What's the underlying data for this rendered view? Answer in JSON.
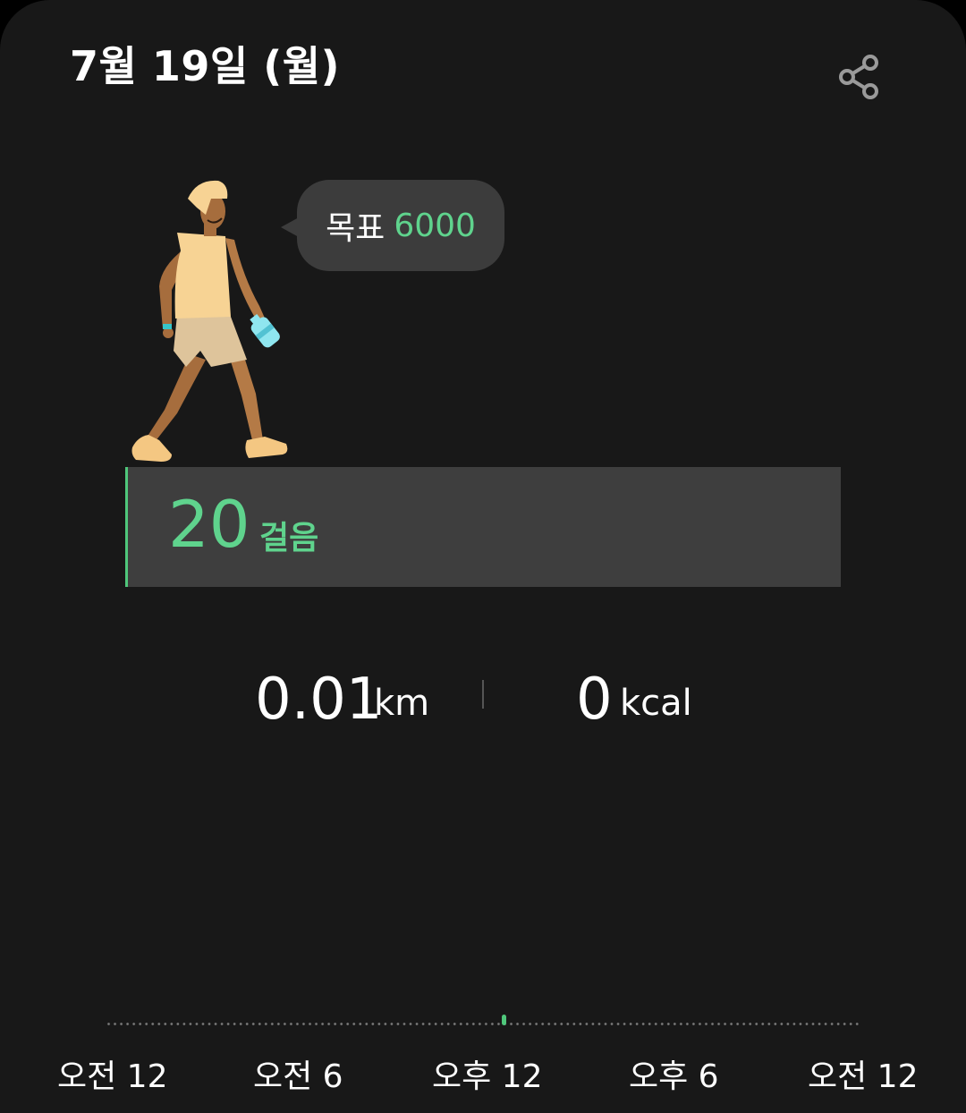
{
  "header": {
    "date": "7월 19일 (월)",
    "share_icon": "share-icon"
  },
  "goal": {
    "label": "목표",
    "value": "6000"
  },
  "steps": {
    "count": "20",
    "unit": "걸음"
  },
  "distance": {
    "value": "0.01",
    "unit": "km"
  },
  "calories": {
    "value": "0",
    "unit": "kcal"
  },
  "timeline": {
    "ticks": [
      "오전 12",
      "오전 6",
      "오후 12",
      "오후 6",
      "오전 12"
    ],
    "accent_color": "#5fd38d"
  }
}
